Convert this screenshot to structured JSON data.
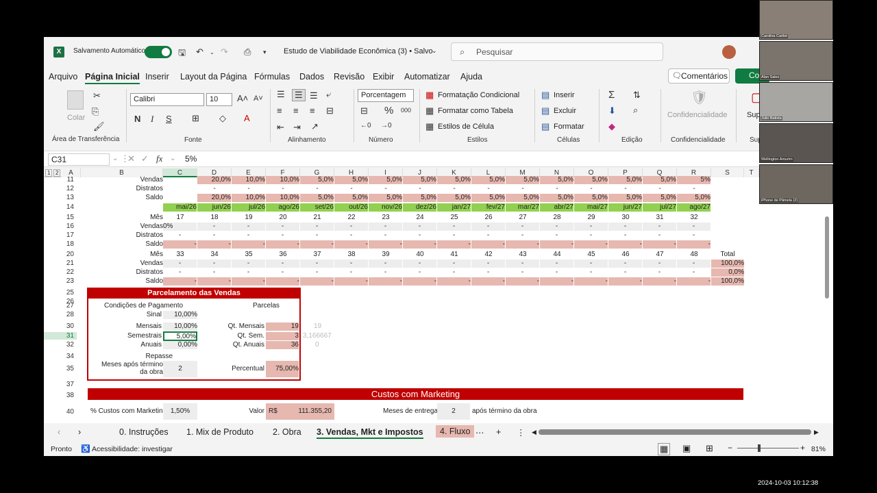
{
  "titlebar": {
    "autosave_label": "Salvamento Automático",
    "toggle": "Ligado",
    "doc_title": "Estudo de Viabilidade Econômica (3) • Salvo",
    "search_placeholder": "Pesquisar"
  },
  "menu": [
    "Arquivo",
    "Página Inicial",
    "Inserir",
    "Layout da Página",
    "Fórmulas",
    "Dados",
    "Revisão",
    "Exibir",
    "Automatizar",
    "Ajuda"
  ],
  "comments_label": "Comentários",
  "share_label": "Co",
  "ribbon": {
    "paste": "Colar",
    "clipboard_group": "Área de Transferência",
    "font_name": "Calibri",
    "font_size": "10",
    "font_group": "Fonte",
    "align_group": "Alinhamento",
    "number_format": "Porcentagem",
    "number_group": "Número",
    "cond_format": "Formatação Condicional",
    "format_table": "Formatar como Tabela",
    "cell_styles": "Estilos de Célula",
    "styles_group": "Estilos",
    "insert": "Inserir",
    "delete": "Excluir",
    "format": "Formatar",
    "cells_group": "Células",
    "edit_group": "Edição",
    "confidentiality": "Confidencialidade",
    "confidentiality_group": "Confidencialidade",
    "super": "Supler",
    "super_group": "Super"
  },
  "formula": {
    "name_box": "C31",
    "value": "5%"
  },
  "columns": [
    "A",
    "B",
    "C",
    "D",
    "E",
    "F",
    "G",
    "H",
    "I",
    "J",
    "K",
    "L",
    "M",
    "N",
    "O",
    "P",
    "Q",
    "R",
    "S",
    "T"
  ],
  "sheet": {
    "lbl_vendas": "Vendas",
    "lbl_distratos": "Distratos",
    "lbl_saldo": "Saldo",
    "lbl_mes": "Mês",
    "lbl_total": "Total",
    "r11": [
      "20,0%",
      "10,0%",
      "10,0%",
      "5,0%",
      "5,0%",
      "5,0%",
      "5,0%",
      "5,0%",
      "5,0%",
      "5,0%",
      "5,0%",
      "5,0%",
      "5,0%",
      "5,0%",
      "5%"
    ],
    "r13": [
      "20,0%",
      "10,0%",
      "10,0%",
      "5,0%",
      "5,0%",
      "5,0%",
      "5,0%",
      "5,0%",
      "5,0%",
      "5,0%",
      "5,0%",
      "5,0%",
      "5,0%",
      "5,0%",
      "5,0%"
    ],
    "months": [
      "mai/26",
      "jun/26",
      "jul/26",
      "ago/26",
      "set/26",
      "out/26",
      "nov/26",
      "dez/26",
      "jan/27",
      "fev/27",
      "mar/27",
      "abr/27",
      "mai/27",
      "jun/27",
      "jul/27",
      "ago/27"
    ],
    "mes1": [
      "17",
      "18",
      "19",
      "20",
      "21",
      "22",
      "23",
      "24",
      "25",
      "26",
      "27",
      "28",
      "29",
      "30",
      "31",
      "32"
    ],
    "mes2": [
      "33",
      "34",
      "35",
      "36",
      "37",
      "38",
      "39",
      "40",
      "41",
      "42",
      "43",
      "44",
      "45",
      "46",
      "47",
      "48"
    ],
    "vendas1_first": "0%",
    "dash": "-",
    "totals": [
      "100,0%",
      "0,0%",
      "100,0%"
    ],
    "parcel": {
      "title": "Parcelamento das Vendas",
      "cond": "Condições de Pagamento",
      "parcelas": "Parcelas",
      "sinal": "Sinal",
      "sinal_v": "10,00%",
      "mensais": "Mensais",
      "mensais_v": "10,00%",
      "semestrais": "Semestrais",
      "semestrais_v": "5,00%",
      "anuais": "Anuais",
      "anuais_v": "0,00%",
      "qt_mensais": "Qt. Mensais",
      "qt_mensais_v": "19",
      "qt_mensais_x": "19",
      "qt_sem": "Qt. Sem.",
      "qt_sem_v": "3",
      "qt_sem_x": "3,166667",
      "qt_anuais": "Qt. Anuais",
      "qt_anuais_v": "36",
      "qt_anuais_x": "0",
      "repasse": "Repasse",
      "meses_apos": "Meses após término da obra",
      "meses_apos_v": "2",
      "percentual": "Percentual",
      "percentual_v": "75,00%"
    },
    "mkt": {
      "title": "Custos com Marketing",
      "pct_label": "% Custos com Marketing",
      "pct_v": "1,50%",
      "valor": "Valor",
      "rs": "R$",
      "valor_v": "111.355,20",
      "meses_entrega": "Meses de entrega",
      "meses_v": "2",
      "apos": "após término da obra"
    }
  },
  "tabs": [
    "0. Instruções",
    "1. Mix de Produto",
    "2. Obra",
    "3. Vendas, Mkt e Impostos",
    "4. Fluxo"
  ],
  "status": {
    "ready": "Pronto",
    "accessibility": "Acessibilidade: investigar",
    "zoom": "81%"
  },
  "participants": [
    "Carolina Caribé",
    "Alan Sales",
    "Julio Batista",
    "Wellington Amurim",
    "iPhone de Pâmela (2)"
  ],
  "timestamp": "2024-10-03  10:12:38"
}
